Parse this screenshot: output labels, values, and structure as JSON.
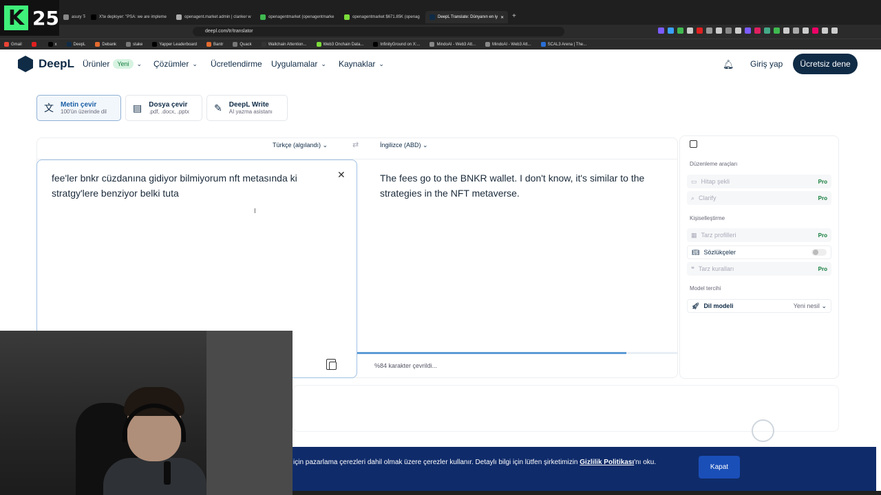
{
  "browser": {
    "tabs": [
      {
        "label": "asury Token",
        "color": "#888"
      },
      {
        "label": "X'te deployer: \"PSA: we are impleme",
        "color": "#000"
      },
      {
        "label": "openagent.market admin | clanker w",
        "color": "#aaa"
      },
      {
        "label": "openagentmarket (openagentmarke",
        "color": "#3fb950"
      },
      {
        "label": "openagentmarket $671.85K (openag",
        "color": "#7bdc3a"
      },
      {
        "label": "DeepL Translate: Dünyanın en iy",
        "color": "#0f2b46",
        "active": true
      }
    ],
    "url": "deepl.com/tr/translator",
    "bookmarks": [
      {
        "label": "Gmail",
        "color": "#ea4335"
      },
      {
        "label": "",
        "color": "#e02020"
      },
      {
        "label": "x",
        "color": "#000"
      },
      {
        "label": "DeepL",
        "color": "#0f2b46"
      },
      {
        "label": "Debank",
        "color": "#e36a2e"
      },
      {
        "label": "stake",
        "color": "#777"
      },
      {
        "label": "Yapper Leaderboard",
        "color": "#000"
      },
      {
        "label": "Bantr",
        "color": "#e36a2e"
      },
      {
        "label": "Quack",
        "color": "#777"
      },
      {
        "label": "Wallchain Attention...",
        "color": "#333"
      },
      {
        "label": "Web3 Onchain Data...",
        "color": "#7bdc3a"
      },
      {
        "label": "InfinityGround on X:...",
        "color": "#000"
      },
      {
        "label": "MindoAI - Web3 Att...",
        "color": "#888"
      },
      {
        "label": "MindoAI - Web3 Att...",
        "color": "#888"
      },
      {
        "label": "SCAL3 Arena | The...",
        "color": "#2a6fd6"
      }
    ],
    "overlay_logo": {
      "letter": "K",
      "number": "25"
    }
  },
  "header": {
    "brand": "DeepL",
    "nav": {
      "products": "Ürünler",
      "new_badge": "Yeni",
      "solutions": "Çözümler",
      "pricing": "Ücretlendirme",
      "apps": "Uygulamalar",
      "resources": "Kaynaklar"
    },
    "login": "Giriş yap",
    "trial": "Ücretsiz dene"
  },
  "modes": [
    {
      "title": "Metin çevir",
      "sub": "100'ün üzerinde dil"
    },
    {
      "title": "Dosya çevir",
      "sub": ".pdf, .docx, .pptx"
    },
    {
      "title": "DeepL Write",
      "sub": "AI yazma asistanı"
    }
  ],
  "translator": {
    "source_lang": "Türkçe (algılandı)",
    "target_lang": "İngilizce (ABD)",
    "source_text": "fee'ler bnkr cüzdanına gidiyor bilmiyorum nft metasında ki stratgy'lere benziyor belki tuta",
    "target_text": "The fees go to the BNKR wallet. I don't know, it's similar to the strategies in the NFT metaverse.",
    "progress_label": "%84 karakter çevrildi...",
    "progress": 0.84
  },
  "side": {
    "editing_tools": "Düzenleme araçları",
    "tone": "Hitap şekli",
    "clarify": "Clarify",
    "personalization": "Kişiselleştirme",
    "style_profiles": "Tarz profilleri",
    "glossaries": "Sözlükçeler",
    "style_rules": "Tarz kuralları",
    "model_pref": "Model tercihi",
    "language_model": "Dil modeli",
    "model_value": "Yeni nesil",
    "pro": "Pro"
  },
  "cookie": {
    "text": "için pazarlama çerezleri dahil olmak üzere çerezler kullanır. Detaylı bilgi için lütfen şirketimizin ",
    "link": "Gizlilik Politikası",
    "suffix": "'nı oku.",
    "button": "Kapat"
  }
}
